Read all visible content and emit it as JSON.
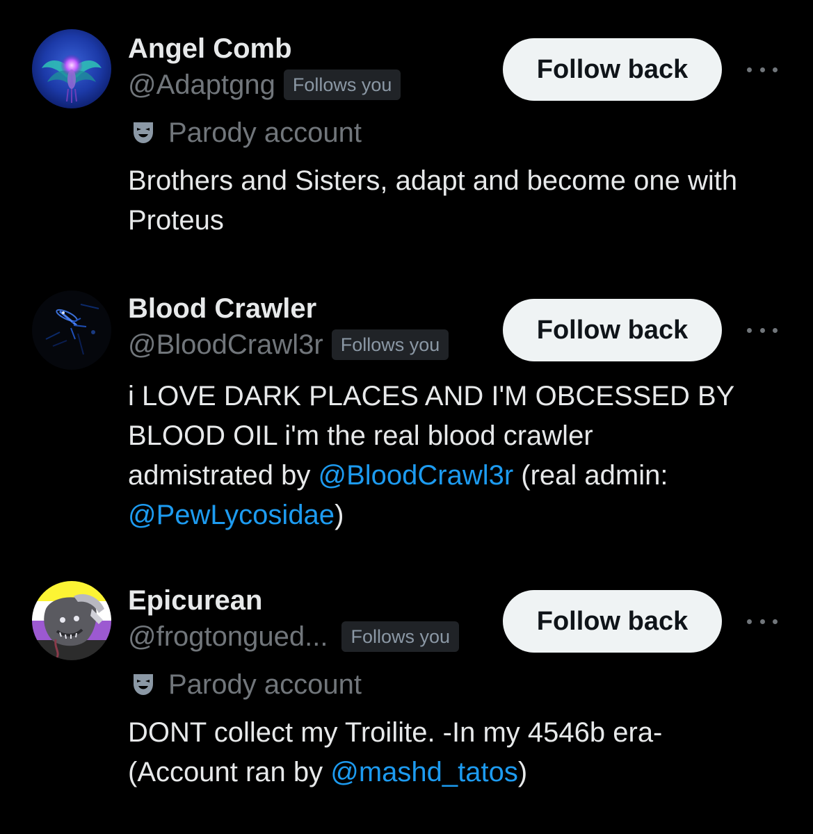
{
  "accounts": [
    {
      "name": "Angel Comb",
      "handle": "@Adaptgng",
      "follows_badge": "Follows you",
      "parody_label": "Parody account",
      "bio_text": "Brothers and Sisters, adapt and become one with Proteus",
      "follow_label": "Follow back",
      "avatar_icon": "glowing-angel-avatar"
    },
    {
      "name": "Blood Crawler",
      "handle": "@BloodCrawl3r",
      "follows_badge": "Follows you",
      "bio_1": "i LOVE DARK PLACES AND I'M OBCESSED BY BLOOD OIL i'm the real blood crawler admistrated by ",
      "mention_1": "@BloodCrawl3r",
      "bio_2": " (real admin: ",
      "mention_2": "@PewLycosidae",
      "bio_3": ")",
      "follow_label": "Follow back",
      "avatar_icon": "dark-crawler-avatar"
    },
    {
      "name": "Epicurean",
      "handle": "@frogtongued...",
      "follows_badge": "Follows you",
      "parody_label": "Parody account",
      "bio_1": "DONT collect my Troilite. -In my 4546b era- (Account ran by ",
      "mention_1": "@mashd_tatos",
      "bio_2": ")",
      "follow_label": "Follow back",
      "avatar_icon": "nonbinary-flag-creature-avatar"
    }
  ],
  "icons": {
    "parody": "theater-mask-icon",
    "more": "more-options-icon"
  },
  "colors": {
    "background": "#000000",
    "primary_text": "#e7e9ea",
    "secondary_text": "#71767b",
    "link": "#1d9bf0",
    "button_bg": "#eff3f4",
    "button_text": "#0f1419",
    "badge_bg": "#202327"
  }
}
